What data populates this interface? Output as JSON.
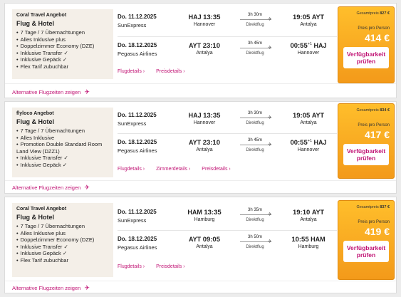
{
  "offers": [
    {
      "provider": "Coral Travel Angebot",
      "title": "Flug & Hotel",
      "features": [
        "7 Tage / 7 Übernachtungen",
        "Alles Inklusive plus",
        "Doppelzimmer Economy (DZE)",
        "Inklusive Transfer ✓",
        "Inklusive Gepäck ✓",
        "Flex Tarif zubuchbar"
      ],
      "outbound": {
        "date": "Do. 11.12.2025",
        "airline": "SunExpress",
        "dep_code": "HAJ",
        "dep_time": "13:35",
        "dep_city": "Hannover",
        "duration": "3h 30m",
        "direct": "Direktflug",
        "arr_time": "19:05",
        "arr_code": "AYT",
        "arr_sup": "",
        "arr_city": "Antalya"
      },
      "return": {
        "date": "Do. 18.12.2025",
        "airline": "Pegasus Airlines",
        "dep_code": "AYT",
        "dep_time": "23:10",
        "dep_city": "Antalya",
        "duration": "3h 45m",
        "direct": "Direktflug",
        "arr_time": "00:55",
        "arr_code": "HAJ",
        "arr_sup": "+1",
        "arr_city": "Hannover"
      },
      "links": [
        "Flugdetails ›",
        "Preisdetails ›"
      ],
      "total_label": "Gesamtpreis",
      "total": "827 €",
      "per_person_label": "Preis pro Person",
      "price": "414 €",
      "button": "Verfügbarkeit prüfen",
      "alt_link": "Alternative Flugzeiten zeigen"
    },
    {
      "provider": "flyloco Angebot",
      "title": "Flug & Hotel",
      "features": [
        "7 Tage / 7 Übernachtungen",
        "Alles Inklusive",
        "Promotion Double Standard Room Land View (DZZ1)",
        "Inklusive Transfer ✓",
        "Inklusive Gepäck ✓"
      ],
      "outbound": {
        "date": "Do. 11.12.2025",
        "airline": "SunExpress",
        "dep_code": "HAJ",
        "dep_time": "13:35",
        "dep_city": "Hannover",
        "duration": "3h 30m",
        "direct": "Direktflug",
        "arr_time": "19:05",
        "arr_code": "AYT",
        "arr_sup": "",
        "arr_city": "Antalya"
      },
      "return": {
        "date": "Do. 18.12.2025",
        "airline": "Pegasus Airlines",
        "dep_code": "AYT",
        "dep_time": "23:10",
        "dep_city": "Antalya",
        "duration": "3h 45m",
        "direct": "Direktflug",
        "arr_time": "00:55",
        "arr_code": "HAJ",
        "arr_sup": "+1",
        "arr_city": "Hannover"
      },
      "links": [
        "Flugdetails ›",
        "Zimmerdetails ›",
        "Preisdetails ›"
      ],
      "total_label": "Gesamtpreis",
      "total": "834 €",
      "per_person_label": "Preis pro Person",
      "price": "417 €",
      "button": "Verfügbarkeit prüfen",
      "alt_link": "Alternative Flugzeiten zeigen"
    },
    {
      "provider": "Coral Travel Angebot",
      "title": "Flug & Hotel",
      "features": [
        "7 Tage / 7 Übernachtungen",
        "Alles Inklusive plus",
        "Doppelzimmer Economy (DZE)",
        "Inklusive Transfer ✓",
        "Inklusive Gepäck ✓",
        "Flex Tarif zubuchbar"
      ],
      "outbound": {
        "date": "Do. 11.12.2025",
        "airline": "SunExpress",
        "dep_code": "HAM",
        "dep_time": "13:35",
        "dep_city": "Hamburg",
        "duration": "3h 35m",
        "direct": "Direktflug",
        "arr_time": "19:10",
        "arr_code": "AYT",
        "arr_sup": "",
        "arr_city": "Antalya"
      },
      "return": {
        "date": "Do. 18.12.2025",
        "airline": "Pegasus Airlines",
        "dep_code": "AYT",
        "dep_time": "09:05",
        "dep_city": "Antalya",
        "duration": "3h 50m",
        "direct": "Direktflug",
        "arr_time": "10:55",
        "arr_code": "HAM",
        "arr_sup": "",
        "arr_city": "Hamburg"
      },
      "links": [
        "Flugdetails ›",
        "Preisdetails ›"
      ],
      "total_label": "Gesamtpreis",
      "total": "837 €",
      "per_person_label": "Preis pro Person",
      "price": "419 €",
      "button": "Verfügbarkeit prüfen",
      "alt_link": "Alternative Flugzeiten zeigen"
    }
  ]
}
